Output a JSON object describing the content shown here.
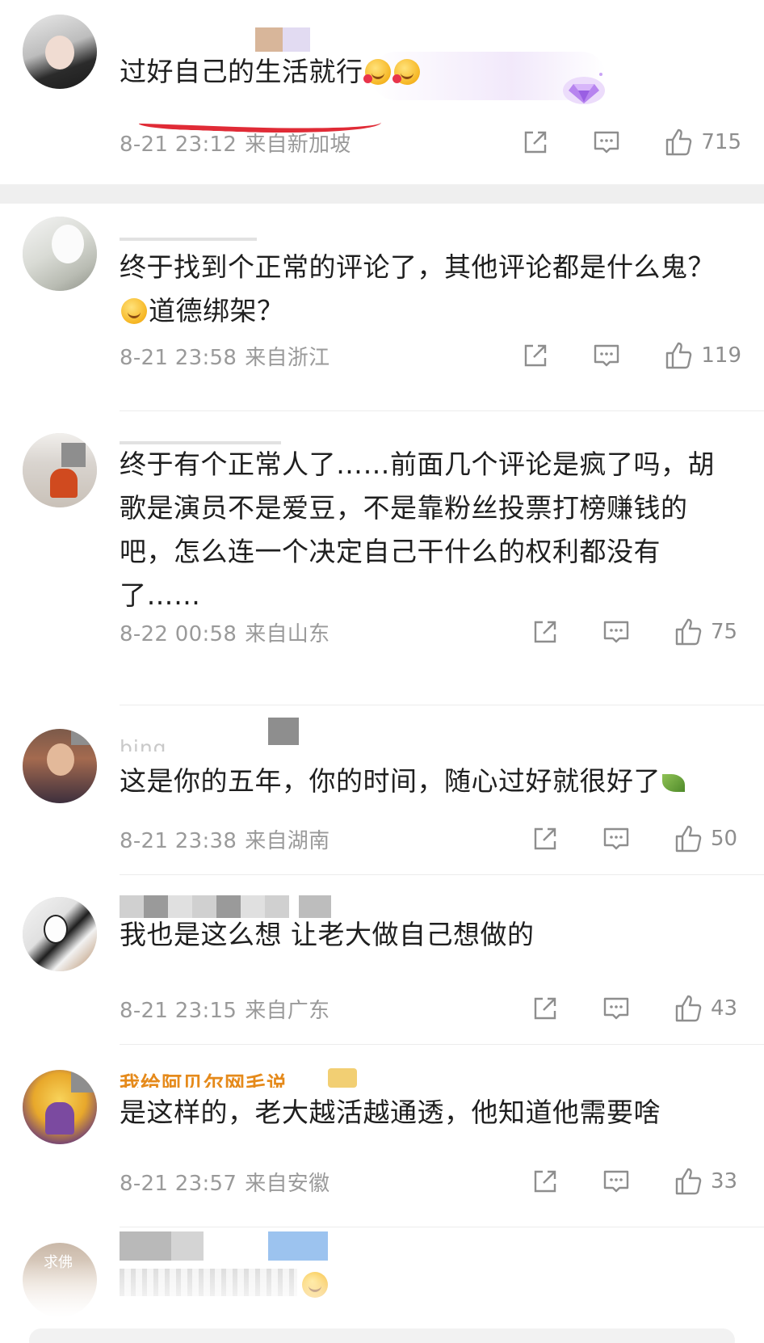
{
  "comments": [
    {
      "username": "",
      "text_before": "过好自己的生活就行",
      "text_after": "",
      "emoji": [
        "heart-face",
        "heart-face"
      ],
      "time": "8-21 23:12",
      "location": "来自新加坡",
      "likes": "715",
      "avatar": "girl-dark-hair"
    },
    {
      "username": "",
      "text_before": "终于找到个正常的评论了，其他评论都是什么鬼？",
      "text_after": "道德绑架？",
      "emoji": [
        "thinking-face"
      ],
      "time": "8-21 23:58",
      "location": "来自浙江",
      "likes": "119",
      "avatar": "white-hair-anime"
    },
    {
      "username": "",
      "text_before": "终于有个正常人了……前面几个评论是疯了吗，胡歌是演员不是爱豆，不是靠粉丝投票打榜赚钱的吧，怎么连一个决定自己干什么的权利都没有了……",
      "text_after": "",
      "emoji": [],
      "time": "8-22 00:58",
      "location": "来自山东",
      "likes": "75",
      "avatar": "person-orange"
    },
    {
      "username": "bing",
      "text_before": "这是你的五年，你的时间，随心过好就很好了",
      "text_after": "",
      "emoji": [
        "leaf"
      ],
      "time": "8-21 23:38",
      "location": "来自湖南",
      "likes": "50",
      "avatar": "woman-photo"
    },
    {
      "username": "",
      "text_before": "我也是这么想 让老大做自己想做的",
      "text_after": "",
      "emoji": [],
      "time": "8-21 23:15",
      "location": "来自广东",
      "likes": "43",
      "avatar": "anime-black-white"
    },
    {
      "username": "我给阿贝尔网毛说",
      "text_before": "是这样的，老大越活越通透，他知道他需要啥",
      "text_after": "",
      "emoji": [],
      "time": "8-21 23:57",
      "location": "来自安徽",
      "likes": "33",
      "avatar": "purple-figure"
    },
    {
      "username": "",
      "avatar_label": "求佛",
      "avatar": "partial"
    }
  ],
  "icons": {
    "share": "share-icon",
    "comment": "comment-icon",
    "like": "thumbs-up-icon"
  },
  "colors": {
    "meta": "#9a9a9a",
    "highlight_line": "#e02b36",
    "divider": "#ececec",
    "vip_name": "#e58a1b"
  }
}
